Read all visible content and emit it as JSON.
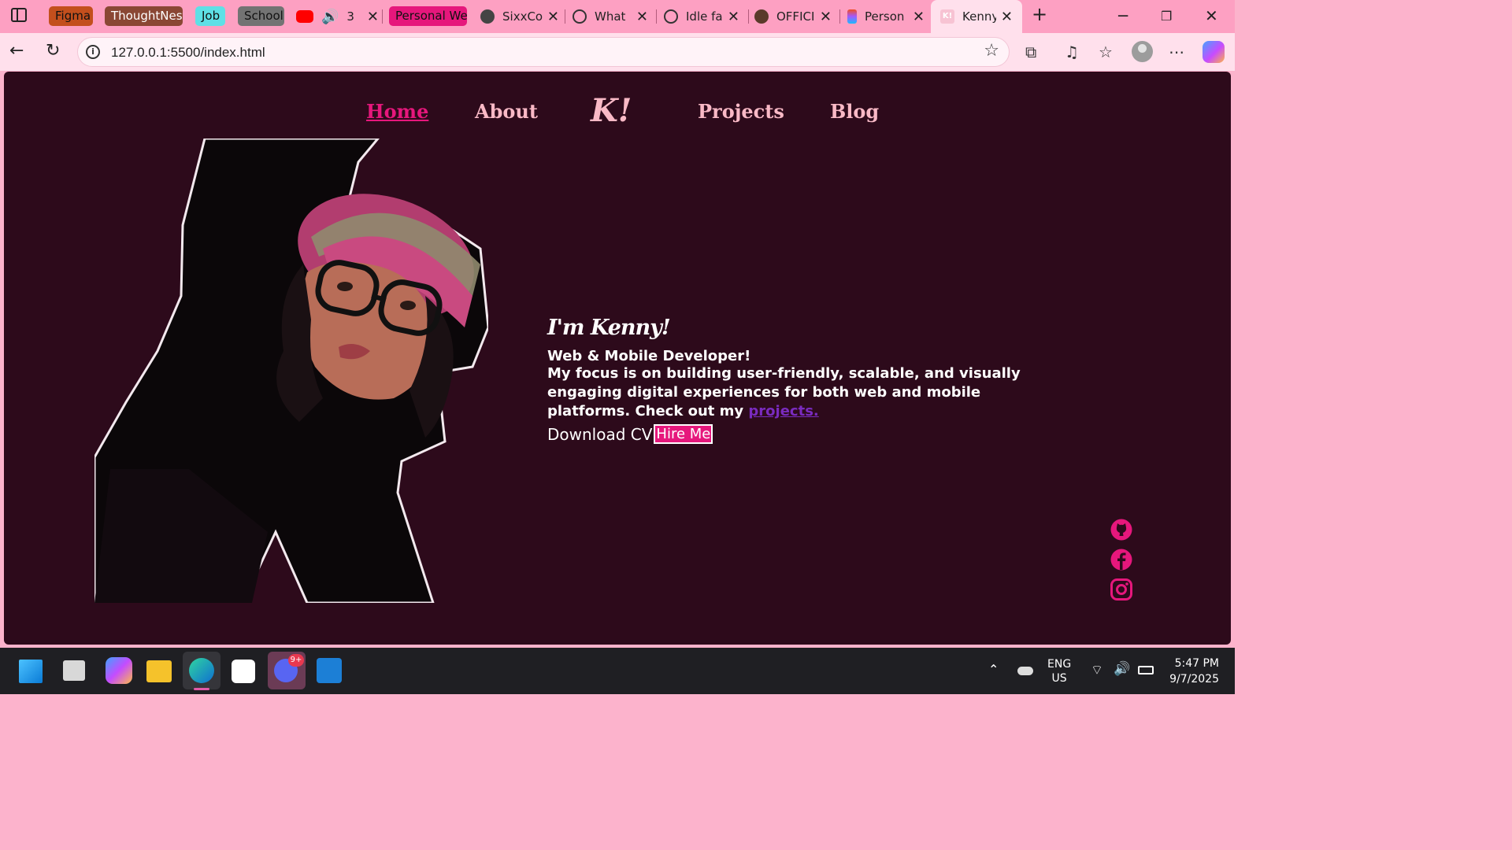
{
  "browser": {
    "tab_groups": [
      {
        "label": "Figma",
        "color": "#c34f1d"
      },
      {
        "label": "ThoughtNest",
        "color": "#8a4734"
      },
      {
        "label": "Job",
        "color": "#5ee0e6"
      },
      {
        "label": "School",
        "color": "#737373"
      }
    ],
    "tabs": [
      {
        "label": "3",
        "icon": "youtube-icon"
      },
      {
        "label": "Personal We",
        "icon": "group-chip"
      },
      {
        "label": "SixxCo",
        "icon": "github-icon"
      },
      {
        "label": "What",
        "icon": "chatgpt-icon"
      },
      {
        "label": "Idle fa",
        "icon": "chatgpt-icon"
      },
      {
        "label": "OFFICI",
        "icon": "site-icon"
      },
      {
        "label": "Person",
        "icon": "figma-icon"
      },
      {
        "label": "Kenny",
        "icon": "k-icon"
      }
    ],
    "url": "127.0.0.1:5500/index.html"
  },
  "site": {
    "nav": {
      "home": "Home",
      "about": "About",
      "logo": "K!",
      "projects": "Projects",
      "blog": "Blog"
    },
    "hero": {
      "greeting": "I'm Kenny!",
      "role": "Web & Mobile Developer!",
      "description": "My focus is on building user-friendly, scalable, and visually engaging digital experiences for both web and mobile platforms. Check out my",
      "projects_link": "projects.",
      "download_cv": "Download CV",
      "hire_me": "Hire Me"
    },
    "socials": [
      "github-icon",
      "facebook-icon",
      "instagram-icon"
    ],
    "accent_color": "#e6177c",
    "background_color": "#2d0a1b"
  },
  "taskbar": {
    "lang_top": "ENG",
    "lang_bottom": "US",
    "time": "5:47 PM",
    "date": "9/7/2025",
    "discord_badge": "9+"
  }
}
